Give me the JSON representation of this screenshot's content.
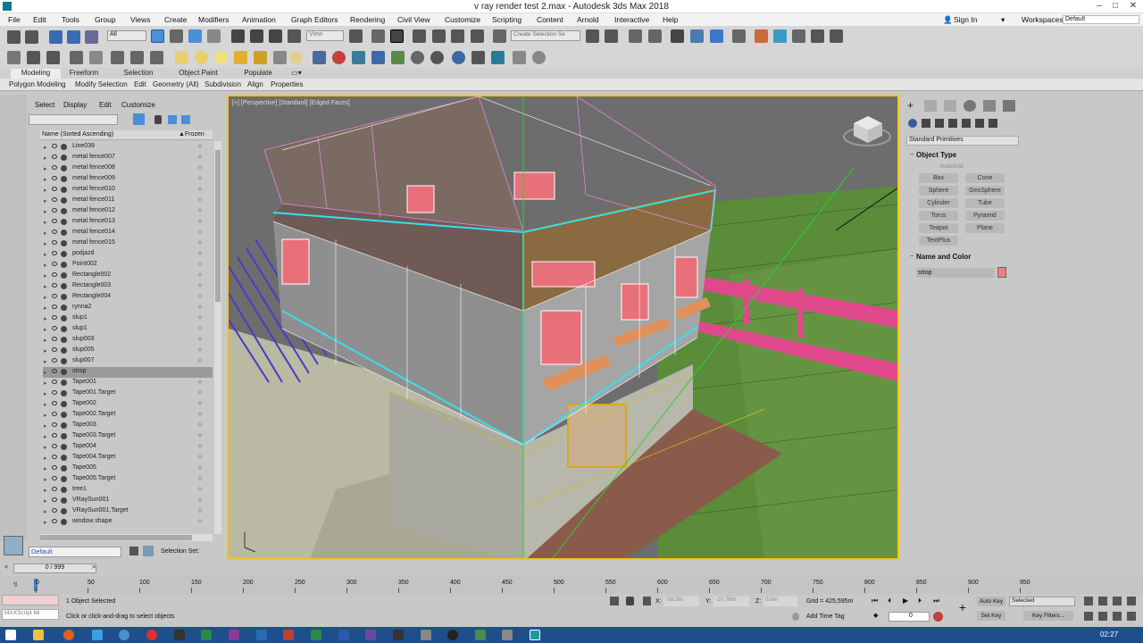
{
  "window": {
    "title": "v ray render test 2.max - Autodesk 3ds Max 2018"
  },
  "menu": [
    "File",
    "Edit",
    "Tools",
    "Group",
    "Views",
    "Create",
    "Modifiers",
    "Animation",
    "Graph Editors",
    "Rendering",
    "Civil View",
    "Customize",
    "Scripting",
    "Content",
    "Arnold",
    "Interactive",
    "Help"
  ],
  "account": {
    "signin": "Sign In",
    "workspaces_label": "Workspaces:",
    "workspace": "Default"
  },
  "toolbar": {
    "filter": "All",
    "view": "View",
    "selection_set": "Create Selection Se"
  },
  "ribbon": {
    "tabs": [
      "Modeling",
      "Freeform",
      "Selection",
      "Object Paint",
      "Populate"
    ],
    "subtabs": [
      "Polygon Modeling",
      "Modify Selection",
      "Edit",
      "Geometry (All)",
      "Subdivision",
      "Align",
      "Properties"
    ]
  },
  "explorer": {
    "tabs": [
      "Select",
      "Display",
      "Edit",
      "Customize"
    ],
    "col_name": "Name (Sorted Ascending)",
    "col_frozen": "Frozen",
    "items": [
      "Line039",
      "metal fence007",
      "metal fence008",
      "metal fence009",
      "metal fence010",
      "metal fence011",
      "metal fence012",
      "metal fence013",
      "metal fence014",
      "metal fence015",
      "podjazd",
      "Point002",
      "Rectangle002",
      "Rectangle003",
      "Rectangle004",
      "rynna2",
      "slup1",
      "slup1",
      "slup003",
      "slup005",
      "slup007",
      "strop",
      "Tape001",
      "Tape001.Target",
      "Tape002",
      "Tape002.Target",
      "Tape003",
      "Tape003.Target",
      "Tape004",
      "Tape004.Target",
      "Tape005",
      "Tape005.Target",
      "tree1",
      "VRaySun001",
      "VRaySun001.Target",
      "window shape"
    ],
    "layer": "Default",
    "selection_set_label": "Selection Set:"
  },
  "viewport": {
    "label": "[+] [Perspective] [Standard] [Edged Faces]"
  },
  "cmdpanel": {
    "category": "Standard Primitives",
    "object_type_title": "Object Type",
    "autogrid": "AutoGrid",
    "buttons": [
      "Box",
      "Cone",
      "Sphere",
      "GeoSphere",
      "Cylinder",
      "Tube",
      "Torus",
      "Pyramid",
      "Teapot",
      "Plane",
      "TextPlus"
    ],
    "name_color_title": "Name and Color",
    "object_name": "strop",
    "object_color": "#f08080"
  },
  "timeline": {
    "frame": "0 / 999",
    "ticks": [
      "0",
      "50",
      "100",
      "150",
      "200",
      "250",
      "300",
      "350",
      "400",
      "450",
      "500",
      "550",
      "600",
      "650",
      "700",
      "750",
      "800",
      "850",
      "900",
      "950"
    ]
  },
  "status": {
    "maxscript": "MAXScript Mi",
    "selected": "1 Object Selected",
    "prompt": "Click or click-and-drag to select objects",
    "x_label": "X:",
    "x": "-58,0m",
    "y_label": "Y:",
    "y": "-10,76m",
    "z_label": "Z:",
    "z": "0,0m",
    "grid": "Grid = 425,595m",
    "add_time_tag": "Add Time Tag",
    "auto_key": "Auto Key",
    "set_key": "Set Key",
    "key_mode": "Selected",
    "key_filters": "Key Filters...",
    "frame_field": "0"
  },
  "taskbar": {
    "time": "02:27"
  },
  "colors": {
    "viewport_border": "#f5c518",
    "selection_wire": "#35e0f0",
    "grass": "#5a8c3a",
    "fence": "#e0488c"
  }
}
